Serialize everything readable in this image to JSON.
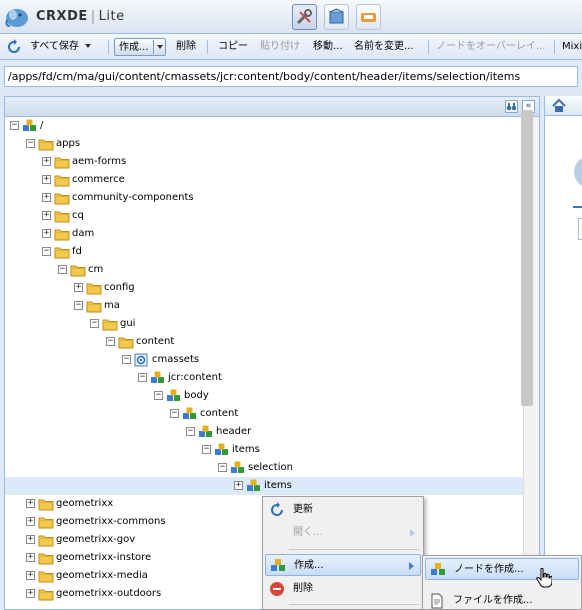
{
  "app": {
    "title_brand": "CRXDE",
    "title_product": "Lite"
  },
  "toolbar": {
    "save_all": "すべて保存",
    "create": "作成...",
    "delete": "削除",
    "copy": "コピー",
    "paste": "貼り付け",
    "move": "移動...",
    "rename": "名前を変更...",
    "overlay": "ノードをオーバーレイ...",
    "mixin": "Mixi"
  },
  "path": {
    "value": "/apps/fd/cm/ma/gui/content/cmassets/jcr:content/body/content/header/items/selection/items"
  },
  "tree": [
    {
      "label": "/",
      "toggle": "−"
    },
    {
      "label": "apps",
      "toggle": "−"
    },
    {
      "label": "aem-forms",
      "toggle": "+"
    },
    {
      "label": "commerce",
      "toggle": "+"
    },
    {
      "label": "community-components",
      "toggle": "+"
    },
    {
      "label": "cq",
      "toggle": "+"
    },
    {
      "label": "dam",
      "toggle": "+"
    },
    {
      "label": "fd",
      "toggle": "−"
    },
    {
      "label": "cm",
      "toggle": "−"
    },
    {
      "label": "config",
      "toggle": "+"
    },
    {
      "label": "ma",
      "toggle": "−"
    },
    {
      "label": "gui",
      "toggle": "−"
    },
    {
      "label": "content",
      "toggle": "−"
    },
    {
      "label": "cmassets",
      "toggle": "−"
    },
    {
      "label": "jcr:content",
      "toggle": "−"
    },
    {
      "label": "body",
      "toggle": "−"
    },
    {
      "label": "content",
      "toggle": "−"
    },
    {
      "label": "header",
      "toggle": "−"
    },
    {
      "label": "items",
      "toggle": "−"
    },
    {
      "label": "selection",
      "toggle": "−"
    },
    {
      "label": "items",
      "toggle": "+"
    },
    {
      "label": "geometrixx",
      "toggle": "+"
    },
    {
      "label": "geometrixx-commons",
      "toggle": "+"
    },
    {
      "label": "geometrixx-gov",
      "toggle": "+"
    },
    {
      "label": "geometrixx-instore",
      "toggle": "+"
    },
    {
      "label": "geometrixx-media",
      "toggle": "+"
    },
    {
      "label": "geometrixx-outdoors",
      "toggle": "+"
    }
  ],
  "context_menu": {
    "refresh": "更新",
    "open": "開く...",
    "create": "作成...",
    "delete": "削除"
  },
  "submenu": {
    "create_node": "ノードを作成...",
    "create_file": "ファイルを作成..."
  }
}
